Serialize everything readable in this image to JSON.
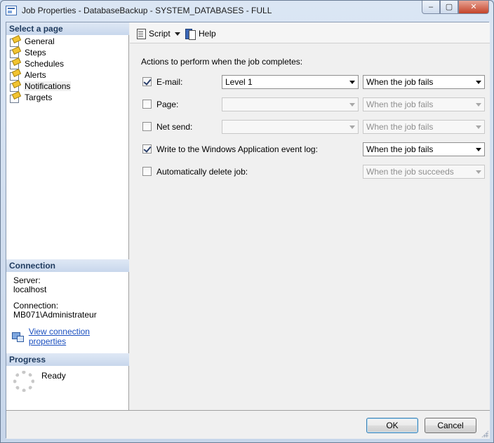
{
  "window": {
    "title": "Job Properties - DatabaseBackup - SYSTEM_DATABASES - FULL",
    "min_label": "–",
    "max_label": "▢",
    "close_label": "✕"
  },
  "left": {
    "select_page_heading": "Select a page",
    "pages": [
      {
        "label": "General"
      },
      {
        "label": "Steps"
      },
      {
        "label": "Schedules"
      },
      {
        "label": "Alerts"
      },
      {
        "label": "Notifications"
      },
      {
        "label": "Targets"
      }
    ],
    "selected_page": "Notifications",
    "connection_heading": "Connection",
    "server_label": "Server:",
    "server_value": "localhost",
    "connection_label": "Connection:",
    "connection_value": "MB071\\Administrateur",
    "view_connection_link": "View connection properties",
    "progress_heading": "Progress",
    "progress_status": "Ready"
  },
  "toolbar": {
    "script_label": "Script",
    "help_label": "Help"
  },
  "notifications": {
    "heading": "Actions to perform when the job completes:",
    "email": {
      "checked": true,
      "label": "E-mail:",
      "operator": "Level 1",
      "condition": "When the job fails"
    },
    "page": {
      "checked": false,
      "label": "Page:",
      "operator": "",
      "condition": "When the job fails"
    },
    "net_send": {
      "checked": false,
      "label": "Net send:",
      "operator": "",
      "condition": "When the job fails"
    },
    "event_log": {
      "checked": true,
      "label": "Write to the Windows Application event log:",
      "condition": "When the job fails"
    },
    "auto_delete": {
      "checked": false,
      "label": "Automatically delete job:",
      "condition": "When the job succeeds"
    }
  },
  "buttons": {
    "ok_label": "OK",
    "cancel_label": "Cancel"
  }
}
